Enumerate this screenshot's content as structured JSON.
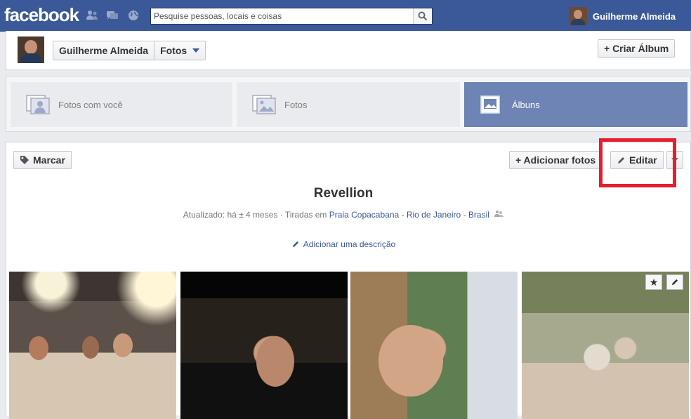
{
  "topbar": {
    "logo": "facebook",
    "search_placeholder": "Pesquise pessoas, locais e coisas",
    "user_name": "Guilherme Almeida"
  },
  "profile_header": {
    "name": "Guilherme Almeida",
    "section": "Fotos",
    "create_album_label": "+ Criar Álbum"
  },
  "tabs": [
    {
      "label": "Fotos com você",
      "icon": "photo-of-you-icon"
    },
    {
      "label": "Fotos",
      "icon": "photos-icon"
    },
    {
      "label": "Álbuns",
      "icon": "albums-icon"
    }
  ],
  "toolbar": {
    "tag_label": "Marcar",
    "add_photos_label": "+ Adicionar fotos",
    "edit_label": "Editar"
  },
  "album": {
    "title": "Revellion",
    "meta_prefix": "Atualizado: há ± 4 meses · Tiradas em",
    "location_parts": [
      "Praia Copacabana",
      "Rio de Janeiro",
      "Brasil"
    ],
    "add_description": "Adicionar uma descrição"
  },
  "colors": {
    "facebook_blue": "#3b5998",
    "active_tab": "#6d84b4",
    "highlight_red": "#e61e2e"
  }
}
